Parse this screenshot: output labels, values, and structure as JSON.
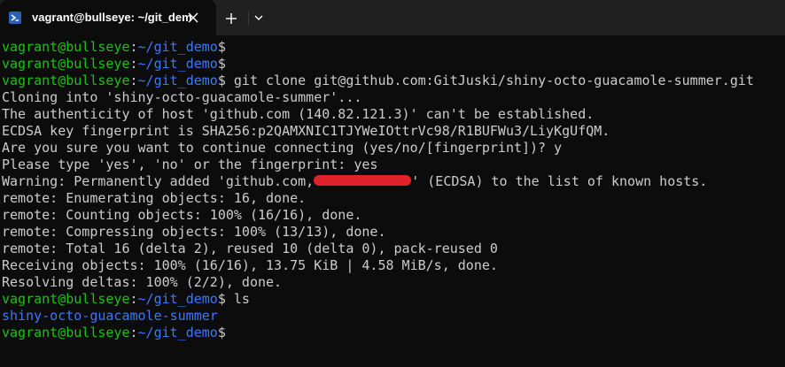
{
  "window": {
    "tab_title": "vagrant@bullseye: ~/git_dem",
    "tab_icon": "powershell-terminal-icon",
    "close_icon": "close-icon",
    "new_tab_icon": "plus-icon",
    "dropdown_icon": "chevron-down-icon"
  },
  "colors": {
    "background": "#0c0c0c",
    "titlebar": "#202020",
    "prompt_user": "#16c60c",
    "prompt_path": "#3b78ff",
    "text": "#cccccc",
    "redaction": "#e0222a"
  },
  "prompt": {
    "user_host": "vagrant@bullseye",
    "colon": ":",
    "path": "~/git_demo",
    "symbol": "$"
  },
  "terminal": {
    "lines": [
      {
        "type": "prompt",
        "command": ""
      },
      {
        "type": "prompt",
        "command": ""
      },
      {
        "type": "prompt",
        "command": " git clone git@github.com:GitJuski/shiny-octo-guacamole-summer.git"
      },
      {
        "type": "output",
        "text": "Cloning into 'shiny-octo-guacamole-summer'..."
      },
      {
        "type": "output",
        "text": "The authenticity of host 'github.com (140.82.121.3)' can't be established."
      },
      {
        "type": "output",
        "text": "ECDSA key fingerprint is SHA256:p2QAMXNIC1TJYWeIOttrVc98/R1BUFWu3/LiyKgUfQM."
      },
      {
        "type": "output",
        "text": "Are you sure you want to continue connecting (yes/no/[fingerprint])? y"
      },
      {
        "type": "output",
        "text": "Please type 'yes', 'no' or the fingerprint: yes"
      },
      {
        "type": "redacted",
        "before": "Warning: Permanently added 'github.com,",
        "after": "' (ECDSA) to the list of known hosts."
      },
      {
        "type": "output",
        "text": "remote: Enumerating objects: 16, done."
      },
      {
        "type": "output",
        "text": "remote: Counting objects: 100% (16/16), done."
      },
      {
        "type": "output",
        "text": "remote: Compressing objects: 100% (13/13), done."
      },
      {
        "type": "output",
        "text": "remote: Total 16 (delta 2), reused 10 (delta 0), pack-reused 0"
      },
      {
        "type": "output",
        "text": "Receiving objects: 100% (16/16), 13.75 KiB | 4.58 MiB/s, done."
      },
      {
        "type": "output",
        "text": "Resolving deltas: 100% (2/2), done."
      },
      {
        "type": "prompt",
        "command": " ls"
      },
      {
        "type": "dir",
        "text": "shiny-octo-guacamole-summer"
      },
      {
        "type": "prompt",
        "command": ""
      }
    ]
  }
}
